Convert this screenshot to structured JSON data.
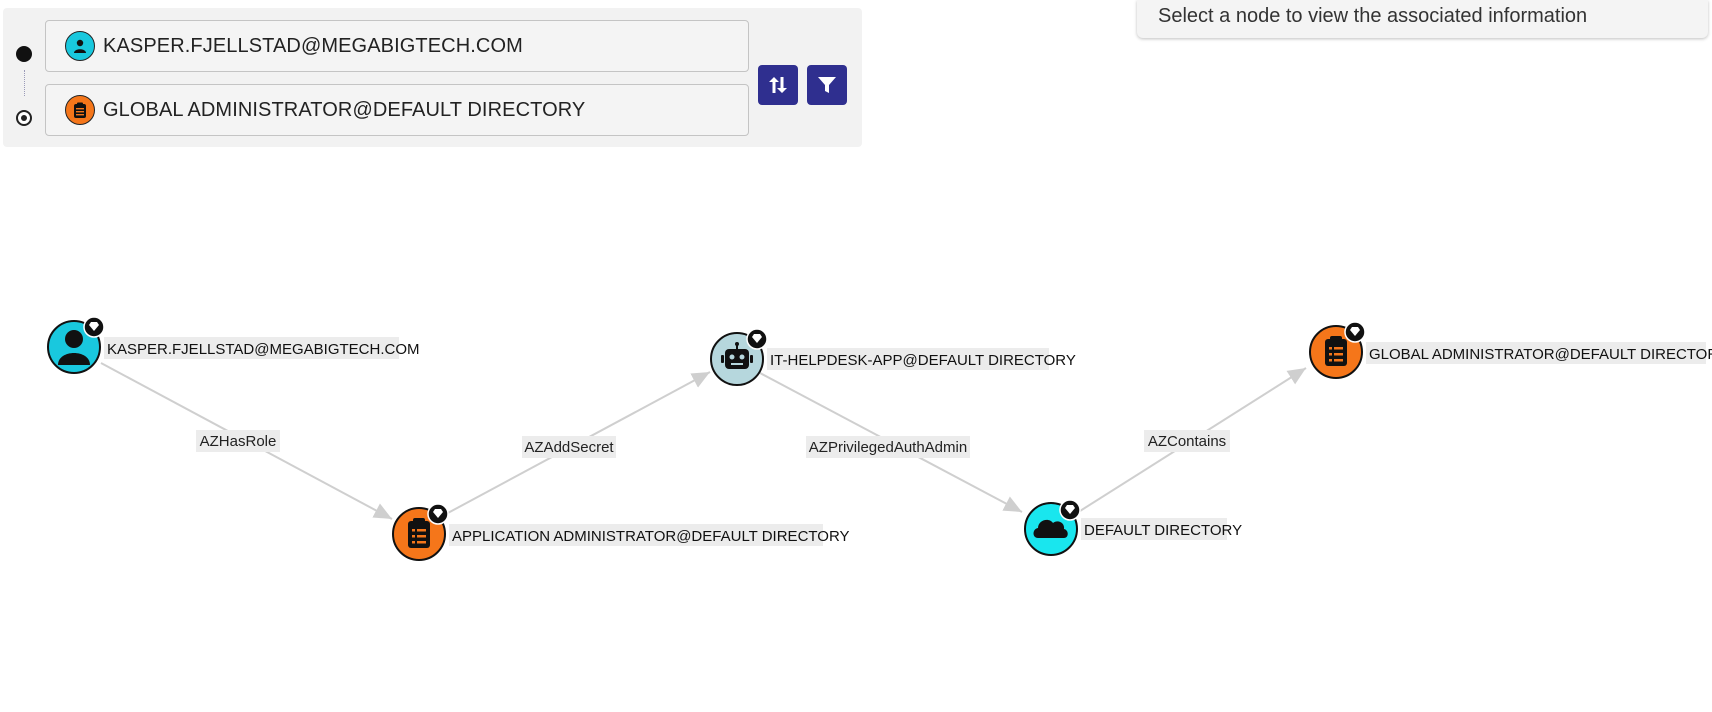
{
  "search": {
    "start_node": "KASPER.FJELLSTAD@MEGABIGTECH.COM",
    "end_node": "GLOBAL ADMINISTRATOR@DEFAULT DIRECTORY",
    "start_icon": "user-icon",
    "end_icon": "role-clipboard-icon",
    "swap_icon": "swap-vertical-icon",
    "filter_icon": "filter-icon"
  },
  "info_panel": {
    "message": "Select a node to view the associated information"
  },
  "colors": {
    "user": "#19c8de",
    "role": "#f5761a",
    "app": "#b6d7dd",
    "tenant": "#19e6ee",
    "button": "#2f2f8f",
    "edge": "#cfcfcf"
  },
  "graph": {
    "nodes": [
      {
        "id": "kasper",
        "label": "KASPER.FJELLSTAD@MEGABIGTECH.COM",
        "type": "user",
        "icon": "user-icon",
        "badge": "tier-zero-gem-icon"
      },
      {
        "id": "appadmin",
        "label": "APPLICATION ADMINISTRATOR@DEFAULT DIRECTORY",
        "type": "role",
        "icon": "role-clipboard-icon",
        "badge": "tier-zero-gem-icon"
      },
      {
        "id": "helpdesk",
        "label": "IT-HELPDESK-APP@DEFAULT DIRECTORY",
        "type": "app",
        "icon": "robot-icon",
        "badge": "tier-zero-gem-icon"
      },
      {
        "id": "directory",
        "label": "DEFAULT DIRECTORY",
        "type": "tenant",
        "icon": "cloud-icon",
        "badge": "tier-zero-gem-icon"
      },
      {
        "id": "globaladmin",
        "label": "GLOBAL ADMINISTRATOR@DEFAULT DIRECTORY",
        "type": "role",
        "icon": "role-clipboard-icon",
        "badge": "tier-zero-gem-icon"
      }
    ],
    "edges": [
      {
        "from": "kasper",
        "to": "appadmin",
        "label": "AZHasRole"
      },
      {
        "from": "appadmin",
        "to": "helpdesk",
        "label": "AZAddSecret"
      },
      {
        "from": "helpdesk",
        "to": "directory",
        "label": "AZPrivilegedAuthAdmin"
      },
      {
        "from": "directory",
        "to": "globaladmin",
        "label": "AZContains"
      }
    ]
  }
}
